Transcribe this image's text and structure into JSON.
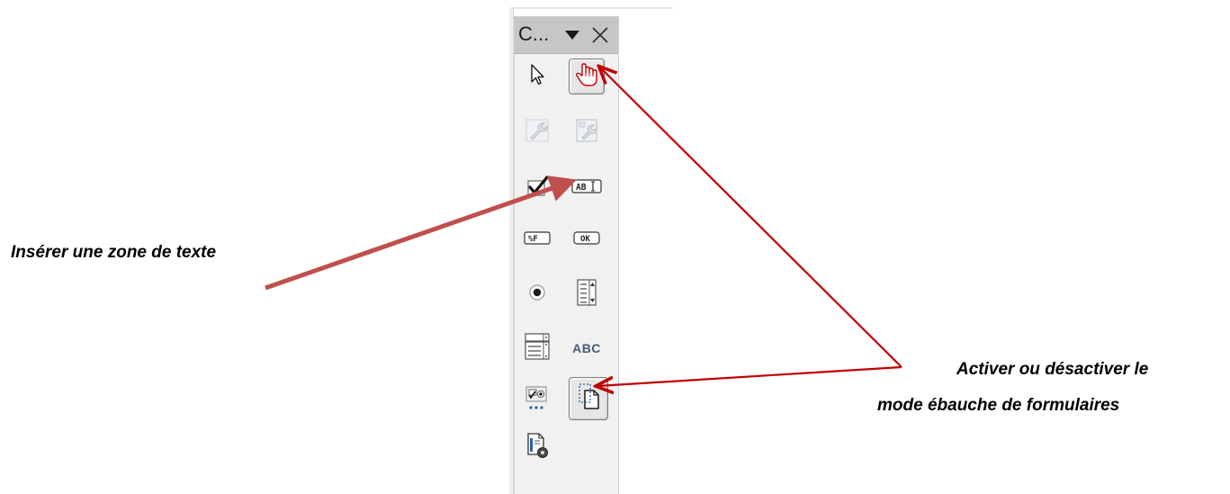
{
  "panel": {
    "title": "C...",
    "dropdown_icon": "triangle-down-icon",
    "close_icon": "close-x-icon"
  },
  "tools": [
    {
      "name": "select-tool",
      "icon": "arrow-pointer-icon",
      "state": "normal"
    },
    {
      "name": "design-mode-toggle",
      "icon": "hand-pointer-icon",
      "state": "pressed"
    },
    {
      "name": "control-properties",
      "icon": "wrench-icon",
      "state": "disabled"
    },
    {
      "name": "form-properties",
      "icon": "form-wrench-icon",
      "state": "disabled"
    },
    {
      "name": "checkbox-tool",
      "icon": "checkbox-icon",
      "state": "normal"
    },
    {
      "name": "text-box-tool",
      "icon": "text-box-icon",
      "label": "AB",
      "state": "normal"
    },
    {
      "name": "formatted-field-tool",
      "icon": "formatted-field-icon",
      "label": "%F",
      "state": "normal"
    },
    {
      "name": "push-button-tool",
      "icon": "push-button-icon",
      "label": "OK",
      "state": "normal"
    },
    {
      "name": "option-button-tool",
      "icon": "radio-button-icon",
      "state": "normal"
    },
    {
      "name": "list-box-tool",
      "icon": "list-box-icon",
      "state": "normal"
    },
    {
      "name": "combo-box-tool",
      "icon": "combo-box-icon",
      "state": "normal"
    },
    {
      "name": "label-field-tool",
      "icon": "label-field-icon",
      "label": "ABC",
      "state": "normal"
    },
    {
      "name": "more-controls-tool",
      "icon": "more-controls-icon",
      "state": "normal"
    },
    {
      "name": "form-design-tool",
      "icon": "form-design-icon",
      "state": "pressed"
    },
    {
      "name": "wizards-tool",
      "icon": "wizard-icon",
      "state": "normal"
    }
  ],
  "annotations": {
    "insert_text_box": "Insérer une zone de texte",
    "toggle_design_line1": "Activer ou désactiver le",
    "toggle_design_line2": "mode ébauche de formulaires"
  },
  "colors": {
    "arrow_red": "#c0504d",
    "arrow_dark_red": "#c00000",
    "panel_title_bg": "#c6c6c6",
    "panel_bg": "#f1f1f1"
  }
}
